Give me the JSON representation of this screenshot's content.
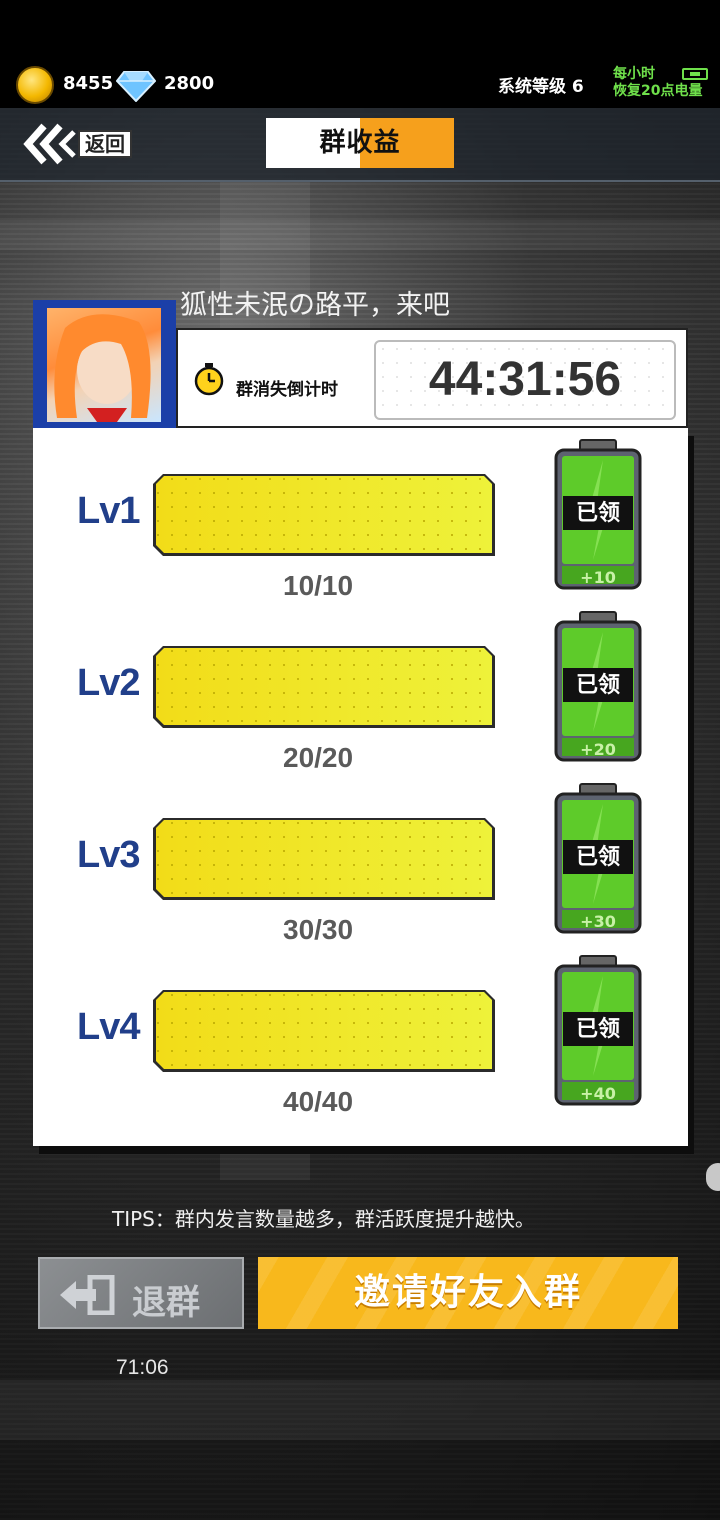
{
  "status": {
    "coins": "8455",
    "gems": "2800",
    "system_level": "系统等级 6",
    "energy_line1": "每小时",
    "energy_line2": "恢复20点电量"
  },
  "header": {
    "back_label": "返回",
    "title": "群收益"
  },
  "group": {
    "name": "狐性未泯の路平，来吧",
    "countdown_label": "群消失倒计时",
    "countdown_value": "44:31:56"
  },
  "levels": [
    {
      "label": "Lv1",
      "progress_text": "10/10",
      "progress": 1.0,
      "reward_status": "已领",
      "reward_amount": "+10"
    },
    {
      "label": "Lv2",
      "progress_text": "20/20",
      "progress": 1.0,
      "reward_status": "已领",
      "reward_amount": "+20"
    },
    {
      "label": "Lv3",
      "progress_text": "30/30",
      "progress": 1.0,
      "reward_status": "已领",
      "reward_amount": "+30"
    },
    {
      "label": "Lv4",
      "progress_text": "40/40",
      "progress": 1.0,
      "reward_status": "已领",
      "reward_amount": "+40"
    }
  ],
  "tips": "TIPS：群内发言数量越多，群活跃度提升越快。",
  "buttons": {
    "quit_label": "退群",
    "invite_label": "邀请好友入群"
  },
  "clock": "71:06",
  "colors": {
    "accent_orange": "#f6a01c",
    "invite_yellow": "#f8b81c",
    "level_blue": "#213f8a",
    "bar_yellow": "#f2e31f",
    "battery_green": "#5ecb2a",
    "energy_green": "#6fe04b"
  },
  "icons": {
    "coin": "coin-icon",
    "gem": "diamond-icon",
    "back": "double-chevron-left-icon",
    "timer": "stopwatch-icon",
    "quit": "exit-door-icon"
  }
}
